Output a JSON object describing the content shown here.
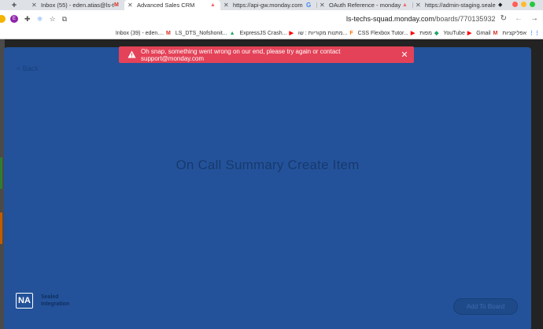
{
  "browser": {
    "new_tab_icon": "+",
    "tabs": [
      {
        "title": "Inbox (55) - eden.atias@ls-t",
        "favicon": "M",
        "favicon_name": "gmail-icon",
        "active": false
      },
      {
        "title": "Advanced Sales CRM",
        "favicon": "▲",
        "favicon_name": "monday-icon",
        "active": true
      },
      {
        "title": "https://api-gw.monday.com",
        "favicon": "G",
        "favicon_name": "google-icon",
        "active": false
      },
      {
        "title": "OAuth Reference - monday",
        "favicon": "▲",
        "favicon_name": "monday-icon",
        "active": false
      },
      {
        "title": "https://admin-staging.seale",
        "favicon": "◆",
        "favicon_name": "mask-icon",
        "active": false
      }
    ],
    "extension_avatar": "E",
    "url_host": "ls-techs-squad.monday.com",
    "url_path": "/boards/770135932",
    "bookmarks": [
      {
        "label": "Inbox (39) - eden....",
        "icon": "M",
        "icon_class": "gm",
        "name": "gmail-icon"
      },
      {
        "label": "LS_DTS_Nofshonit...",
        "icon": "▲",
        "icon_class": "gd",
        "name": "drive-icon"
      },
      {
        "label": "ExpressJS Crash...",
        "icon": "▶",
        "icon_class": "yt",
        "name": "youtube-icon"
      },
      {
        "label": "מתנות מקוריות : שו...",
        "icon": "F",
        "icon_class": "fp",
        "name": "flag-icon"
      },
      {
        "label": "CSS Flexbox Tutor...",
        "icon": "▶",
        "icon_class": "yt",
        "name": "youtube-icon"
      },
      {
        "label": "מפות",
        "icon": "◆",
        "icon_class": "gd",
        "name": "maps-icon"
      },
      {
        "label": "YouTube",
        "icon": "▶",
        "icon_class": "yt",
        "name": "youtube-icon"
      },
      {
        "label": "Gmail",
        "icon": "M",
        "icon_class": "gm",
        "name": "gmail-icon"
      },
      {
        "label": "אפליקציות",
        "icon": "⋮⋮",
        "icon_class": "grid",
        "name": "apps-grid-icon"
      }
    ]
  },
  "toast": {
    "message": "Oh snap, something went wrong on our end, please try again or contact support@monday.com",
    "close_icon": "✕"
  },
  "modal": {
    "back_label": "< Back",
    "title": "On Call Summary Create Item",
    "brand_logo": "NA",
    "brand_line1": "Sealed",
    "brand_line2": "Integration",
    "add_button_label": "Add To Board"
  },
  "colors": {
    "modal_bg": "#24529a",
    "toast_bg": "#e44258",
    "title_text": "#163a6e"
  }
}
